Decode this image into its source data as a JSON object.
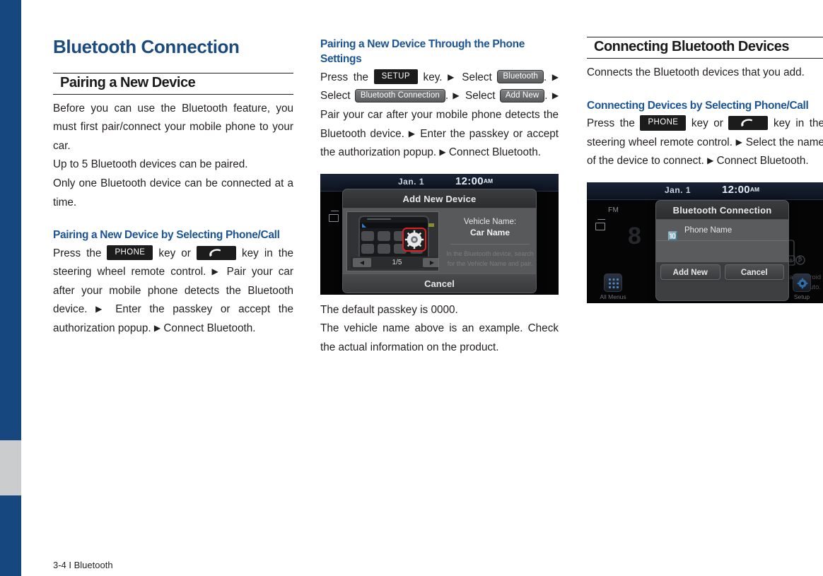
{
  "document": {
    "title": "Bluetooth Connection",
    "footer": "3-4 I Bluetooth",
    "accent_blue": "#1b4a7e",
    "subhead_blue": "#1b5596",
    "edge_bar_color": "#17477f",
    "edge_bar_gray": "#cacccd"
  },
  "col1": {
    "section_heading": "Pairing a New Device",
    "intro_p1": "Before you can use the Bluetooth feature, you must first pair/connect your mobile phone to your car.",
    "intro_p2": "Up to 5 Bluetooth devices can be paired.",
    "intro_p3": "Only one Bluetooth device can be connected at a time.",
    "subhead": "Pairing a New Device by Selecting Phone/Call",
    "step_1": "Press the",
    "key_phone": "PHONE",
    "step_2": "key or",
    "key_call_icon": "phone-handset-icon",
    "step_3": "key in the steering wheel remote  control.",
    "step_4": "Pair your car after your mobile phone detects the Bluetooth device.",
    "step_5": "Enter the passkey or accept the authorization popup.",
    "step_6": "Connect Bluetooth.",
    "arrow": "▶"
  },
  "col2": {
    "subhead": "Pairing a New Device Through the Phone Settings",
    "step_1": "Press the",
    "key_setup": "SETUP",
    "step_2": "key.",
    "step_3": "Select",
    "chip_bluetooth": "Bluetooth",
    "step_4": ".",
    "step_5": "Select",
    "chip_bluetooth_connection": "Bluetooth Connection",
    "step_6": ".",
    "step_7": "Select",
    "chip_add_new": "Add New",
    "step_8": ".",
    "step_9": "Pair your car after your mobile phone detects the Bluetooth device.",
    "step_10": "Enter the passkey or accept the authorization popup.",
    "step_11": "Connect Bluetooth.",
    "note_1": "The default passkey is 0000.",
    "note_2": "The vehicle name above is an example. Check the actual information on the product.",
    "screenshot": {
      "status_date": "Jan.   1",
      "status_time": "12:00",
      "status_ampm": "AM",
      "dialog_title": "Add New Device",
      "vehicle_name_label": "Vehicle Name:",
      "vehicle_name_value": "Car Name",
      "instruction": "In the Bluetooth device, search for the Vehicle Name and pair.",
      "pager": "1/5",
      "cancel": "Cancel"
    }
  },
  "col3": {
    "section_heading": "Connecting Bluetooth Devices",
    "intro": "Connects the Bluetooth devices that you add.",
    "subhead": "Connecting Devices by Selecting Phone/Call",
    "step_1": "Press the",
    "key_phone": "PHONE",
    "step_2": "key or",
    "key_call_icon": "phone-handset-icon",
    "step_3": "key in the steering wheel remote  control.",
    "step_4": "Select the name of the device to connect.",
    "step_5": "Connect Bluetooth.",
    "screenshot": {
      "status_date": "Jan.   1",
      "status_time": "12:00",
      "status_ampm": "AM",
      "source_label": "FM",
      "dialog_title": "Bluetooth Connection",
      "device_name": "Phone Name",
      "btn_add_new": "Add New",
      "btn_cancel": "Cancel",
      "hint_text": "t a device\nnes such as\nAndroid Auto.",
      "all_menus": "All Menus",
      "setup": "Setup"
    }
  }
}
